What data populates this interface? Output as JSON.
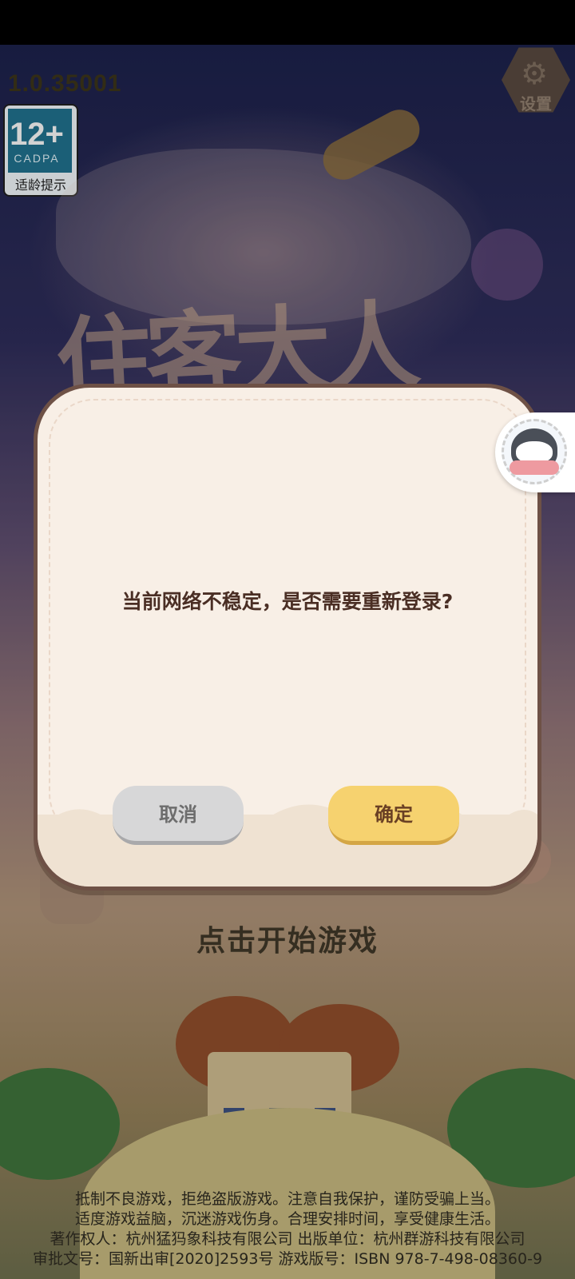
{
  "game": {
    "version": "1.0.35001",
    "settings_label": "设置",
    "age_rating": {
      "age": "12+",
      "org": "CADPA",
      "tip": "适龄提示"
    },
    "title_logo": "住客大人",
    "start_prompt": "点击开始游戏",
    "notice_lines": [
      "抵制不良游戏，拒绝盗版游戏。注意自我保护，谨防受骗上当。",
      "适度游戏益脑，沉迷游戏伤身。合理安排时间，享受健康生活。",
      "著作权人：杭州猛犸象科技有限公司     出版单位：杭州群游科技有限公司",
      "审批文号：国新出审[2020]2593号     游戏版号：ISBN 978-7-498-08360-9"
    ]
  },
  "dialog": {
    "message": "当前网络不稳定，是否需要重新登录?",
    "cancel_label": "取消",
    "confirm_label": "确定"
  },
  "icons": {
    "settings": "gear-icon",
    "assistant": "penguin-assistant-icon"
  }
}
